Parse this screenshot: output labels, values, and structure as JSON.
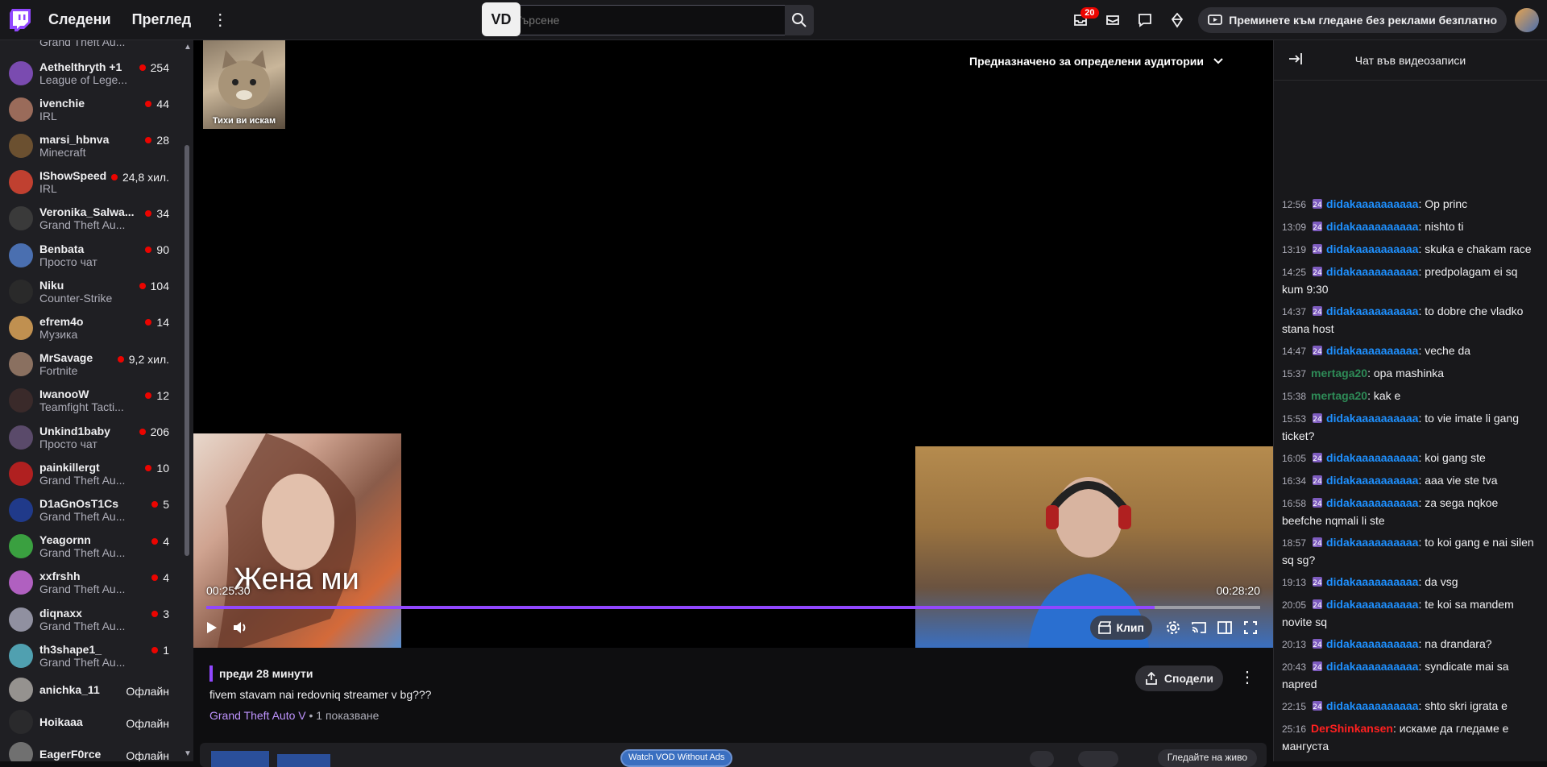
{
  "topbar": {
    "following": "Следени",
    "browse": "Преглед",
    "search_placeholder": "Търсене",
    "ext_label": "VD",
    "notif_count": "20",
    "adfree_label": "Преминете към гледане без реклами безплатно"
  },
  "sidebar": {
    "partial_top": "Grand Theft Au...",
    "items": [
      {
        "name": "Aethelthryth +1",
        "cat": "League of Lege...",
        "viewers": "254",
        "color": "#7a4bb0"
      },
      {
        "name": "ivenchie",
        "cat": "IRL",
        "viewers": "44",
        "color": "#9a6b5a"
      },
      {
        "name": "marsi_hbnva",
        "cat": "Minecraft",
        "viewers": "28",
        "color": "#6b5030"
      },
      {
        "name": "IShowSpeed",
        "cat": "IRL",
        "viewers": "24,8 хил.",
        "color": "#c04030"
      },
      {
        "name": "Veronika_Salwa...",
        "cat": "Grand Theft Au...",
        "viewers": "34",
        "color": "#3a3a3a"
      },
      {
        "name": "Benbata",
        "cat": "Просто чат",
        "viewers": "90",
        "color": "#4a6fb0"
      },
      {
        "name": "Niku",
        "cat": "Counter-Strike",
        "viewers": "104",
        "color": "#2a2a2a"
      },
      {
        "name": "efrem4o",
        "cat": "Музика",
        "viewers": "14",
        "color": "#c09050"
      },
      {
        "name": "MrSavage",
        "cat": "Fortnite",
        "viewers": "9,2 хил.",
        "color": "#8a7060"
      },
      {
        "name": "IwanooW",
        "cat": "Teamfight Tacti...",
        "viewers": "12",
        "color": "#3a2a2a"
      },
      {
        "name": "Unkind1baby",
        "cat": "Просто чат",
        "viewers": "206",
        "color": "#5a4a6a"
      },
      {
        "name": "painkillergt",
        "cat": "Grand Theft Au...",
        "viewers": "10",
        "color": "#b02020"
      },
      {
        "name": "D1aGnOsT1Cs",
        "cat": "Grand Theft Au...",
        "viewers": "5",
        "color": "#203a8a"
      },
      {
        "name": "Yeagornn",
        "cat": "Grand Theft Au...",
        "viewers": "4",
        "color": "#3aa040"
      },
      {
        "name": "xxfrshh",
        "cat": "Grand Theft Au...",
        "viewers": "4",
        "color": "#b060c0"
      },
      {
        "name": "diqnaxx",
        "cat": "Grand Theft Au...",
        "viewers": "3",
        "color": "#9090a0"
      },
      {
        "name": "th3shape1_",
        "cat": "Grand Theft Au...",
        "viewers": "1",
        "color": "#50a0b0"
      }
    ],
    "offline": [
      {
        "name": "anichka_11",
        "status": "Офлайн",
        "color": "#a09080"
      },
      {
        "name": "Hoikaaa",
        "status": "Офлайн",
        "color": "#2a2a30"
      },
      {
        "name": "EagerF0rce",
        "status": "Офлайн",
        "color": "#707070"
      }
    ]
  },
  "player": {
    "cat_caption": "Тихи ви искам",
    "audience_label": "Предназначено за определени аудитории",
    "woman_caption": "Жена ми",
    "time_current": "00:25:30",
    "time_total": "00:28:20",
    "progress": 0.9,
    "clip_label": "Клип"
  },
  "info": {
    "posted": "преди 28 минути",
    "title": "fivem stavam nai redovniq streamer v bg???",
    "game": "Grand Theft Auto V",
    "views": " • 1 показване",
    "share_label": "Сподели",
    "vod_label": "Watch VOD Without Ads",
    "pill_label": "Гледайте на живо"
  },
  "chat": {
    "header": "Чат във видеозаписи",
    "messages": [
      {
        "t": "12:56",
        "user": "didakaaaaaaaaaa",
        "color": "#1e90ff",
        "badge": true,
        "text": ": Op princ"
      },
      {
        "t": "13:09",
        "user": "didakaaaaaaaaaa",
        "color": "#1e90ff",
        "badge": true,
        "text": ": nishto ti"
      },
      {
        "t": "13:19",
        "user": "didakaaaaaaaaaa",
        "color": "#1e90ff",
        "badge": true,
        "text": ": skuka e chakam race"
      },
      {
        "t": "14:25",
        "user": "didakaaaaaaaaaa",
        "color": "#1e90ff",
        "badge": true,
        "text": ": predpolagam ei sq kum 9:30"
      },
      {
        "t": "14:37",
        "user": "didakaaaaaaaaaa",
        "color": "#1e90ff",
        "badge": true,
        "text": ": to dobre che vladko stana host"
      },
      {
        "t": "14:47",
        "user": "didakaaaaaaaaaa",
        "color": "#1e90ff",
        "badge": true,
        "text": ": veche da"
      },
      {
        "t": "15:37",
        "user": "mertaga20",
        "color": "#2e8b57",
        "badge": false,
        "text": ": opa mashinka"
      },
      {
        "t": "15:38",
        "user": "mertaga20",
        "color": "#2e8b57",
        "badge": false,
        "text": ": kak e"
      },
      {
        "t": "15:53",
        "user": "didakaaaaaaaaaa",
        "color": "#1e90ff",
        "badge": true,
        "text": ": to vie imate li gang ticket?"
      },
      {
        "t": "16:05",
        "user": "didakaaaaaaaaaa",
        "color": "#1e90ff",
        "badge": true,
        "text": ": koi gang ste"
      },
      {
        "t": "16:34",
        "user": "didakaaaaaaaaaa",
        "color": "#1e90ff",
        "badge": true,
        "text": ": aaa vie ste tva"
      },
      {
        "t": "16:58",
        "user": "didakaaaaaaaaaa",
        "color": "#1e90ff",
        "badge": true,
        "text": ": za sega nqkoe beefche nqmali li ste"
      },
      {
        "t": "18:57",
        "user": "didakaaaaaaaaaa",
        "color": "#1e90ff",
        "badge": true,
        "text": ": to koi gang e nai silen sq sg?"
      },
      {
        "t": "19:13",
        "user": "didakaaaaaaaaaa",
        "color": "#1e90ff",
        "badge": true,
        "text": ": da vsg"
      },
      {
        "t": "20:05",
        "user": "didakaaaaaaaaaa",
        "color": "#1e90ff",
        "badge": true,
        "text": ": te koi sa mandem novite sq"
      },
      {
        "t": "20:13",
        "user": "didakaaaaaaaaaa",
        "color": "#1e90ff",
        "badge": true,
        "text": ": na drandara?"
      },
      {
        "t": "20:43",
        "user": "didakaaaaaaaaaa",
        "color": "#1e90ff",
        "badge": true,
        "text": ": syndicate mai sa napred"
      },
      {
        "t": "22:15",
        "user": "didakaaaaaaaaaa",
        "color": "#1e90ff",
        "badge": true,
        "text": ": shto skri igrata e"
      },
      {
        "t": "25:16",
        "user": "DerShinkansen",
        "color": "#ff2020",
        "badge": false,
        "text": ": искаме да гледаме е мангуста"
      }
    ]
  },
  "colors": {
    "accent": "#9147ff",
    "live": "#eb0400",
    "bg": "#0e0e10"
  }
}
